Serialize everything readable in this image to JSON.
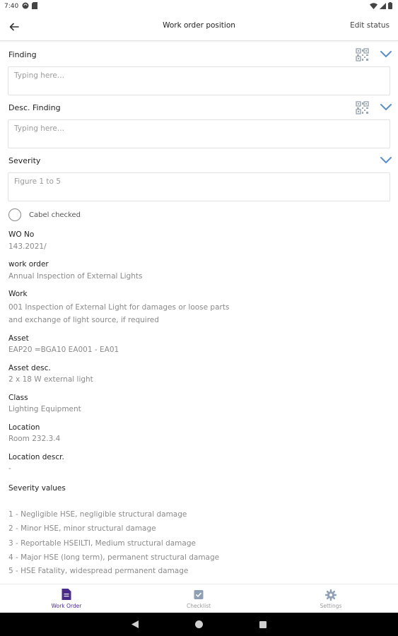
{
  "status_bar": {
    "time": "7:40"
  },
  "app_bar": {
    "title": "Work order position",
    "edit_status": "Edit status"
  },
  "form": {
    "finding": {
      "label": "Finding",
      "placeholder": "Typing here..."
    },
    "desc_finding": {
      "label": "Desc. Finding",
      "placeholder": "Typing here..."
    },
    "severity": {
      "label": "Severity",
      "placeholder": "Figure 1 to 5"
    },
    "cabel_checked": {
      "label": "Cabel checked",
      "checked": false
    }
  },
  "details": {
    "wo_no": {
      "label": "WO No",
      "value": "143.2021/"
    },
    "work_order": {
      "label": "work order",
      "value": "Annual Inspection of External Lights"
    },
    "work": {
      "label": "Work",
      "line1": "001 Inspection of External Light for damages or loose parts",
      "line2": "and exchange of light source, if required"
    },
    "asset": {
      "label": "Asset",
      "value": "EAP20 =BGA10 EA001 - EA01"
    },
    "asset_desc": {
      "label": "Asset desc.",
      "value": "2 x 18 W external light"
    },
    "class": {
      "label": "Class",
      "value": "Lighting Equipment"
    },
    "location": {
      "label": "Location",
      "value": "Room 232.3.4"
    },
    "location_descr": {
      "label": "Location descr.",
      "value": "-"
    }
  },
  "severity_values": {
    "label": "Severity values",
    "items": [
      " 1 - Negligible HSE, negligible structural damage",
      "2 - Minor HSE, minor structural damage",
      "3 - Reportable HSEILTI, Medium structural damage",
      "4 - Major HSE (long term), permanent structural damage",
      "5 - HSE Fatality, widespread permanent damage"
    ]
  },
  "bottom_nav": {
    "items": [
      {
        "label": "Work Order",
        "icon": "document-icon",
        "active": true
      },
      {
        "label": "Checklist",
        "icon": "checkbox-icon",
        "active": false
      },
      {
        "label": "Settings",
        "icon": "gear-icon",
        "active": false
      }
    ]
  },
  "colors": {
    "accent": "#4a2b8a",
    "chevron": "#5b8ec9",
    "qr": "#9aa6b2"
  }
}
